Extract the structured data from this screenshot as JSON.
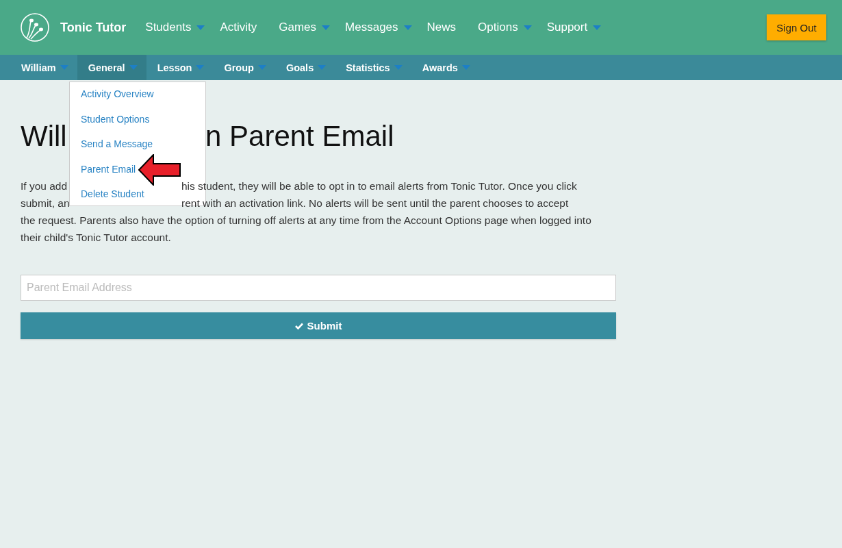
{
  "header": {
    "brand": "Tonic Tutor",
    "nav": [
      {
        "label": "Students",
        "dropdown": true
      },
      {
        "label": "Activity",
        "dropdown": false
      },
      {
        "label": "Games",
        "dropdown": true
      },
      {
        "label": "Messages",
        "dropdown": true
      },
      {
        "label": "News",
        "dropdown": false
      },
      {
        "label": "Options",
        "dropdown": true
      },
      {
        "label": "Support",
        "dropdown": true
      }
    ],
    "sign_out": "Sign Out"
  },
  "subnav": [
    {
      "label": "William",
      "dropdown": true,
      "selected": false
    },
    {
      "label": "General",
      "dropdown": true,
      "selected": true
    },
    {
      "label": "Lesson",
      "dropdown": true,
      "selected": false
    },
    {
      "label": "Group",
      "dropdown": true,
      "selected": false
    },
    {
      "label": "Goals",
      "dropdown": true,
      "selected": false
    },
    {
      "label": "Statistics",
      "dropdown": true,
      "selected": false
    },
    {
      "label": "Awards",
      "dropdown": true,
      "selected": false
    }
  ],
  "dropdown_menu": [
    {
      "label": "Activity Overview"
    },
    {
      "label": "Student Options"
    },
    {
      "label": "Send a Message"
    },
    {
      "label": "Parent Email"
    },
    {
      "label": "Delete Student"
    }
  ],
  "page": {
    "title_parts": [
      "Will",
      "n Parent Email"
    ],
    "intro_lines": [
      {
        "parts": [
          "If you add",
          "his student, they will be able to opt in to email alerts from Tonic Tutor. Once you click"
        ]
      },
      {
        "parts": [
          "submit, an",
          "rent with an activation link. No alerts will be sent until the parent chooses to accept"
        ]
      },
      {
        "parts": [
          "the request. Parents also have the option of turning off alerts at any time from the Account Options page when logged into"
        ]
      },
      {
        "parts": [
          "their child's Tonic Tutor account."
        ]
      }
    ]
  },
  "form": {
    "email": {
      "placeholder": "Parent Email Address"
    },
    "submit": "Submit"
  }
}
